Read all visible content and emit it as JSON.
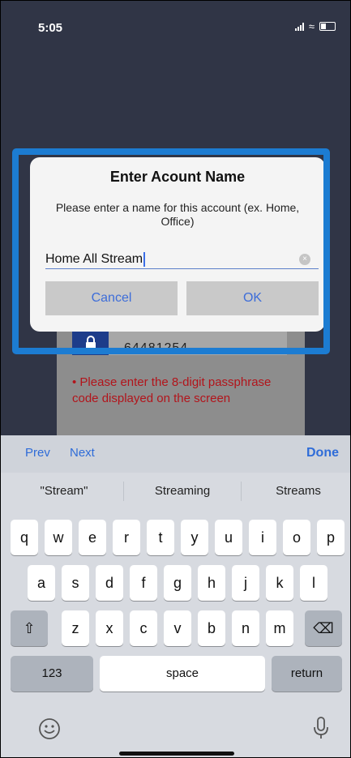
{
  "status_bar": {
    "time": "5:05"
  },
  "background": {
    "code": "64481254",
    "hint": "• Please enter the 8-digit passphrase code displayed on the screen"
  },
  "dialog": {
    "title": "Enter Acount Name",
    "message": "Please enter a name for this account (ex. Home, Office)",
    "input_value": "Home All Stream",
    "cancel_label": "Cancel",
    "ok_label": "OK"
  },
  "accessory_bar": {
    "prev": "Prev",
    "next": "Next",
    "done": "Done"
  },
  "suggestions": [
    "\"Stream\"",
    "Streaming",
    "Streams"
  ],
  "keyboard": {
    "row1": [
      "q",
      "w",
      "e",
      "r",
      "t",
      "y",
      "u",
      "i",
      "o",
      "p"
    ],
    "row2": [
      "a",
      "s",
      "d",
      "f",
      "g",
      "h",
      "j",
      "k",
      "l"
    ],
    "row3": [
      "z",
      "x",
      "c",
      "v",
      "b",
      "n",
      "m"
    ],
    "numbers": "123",
    "space": "space",
    "return": "return"
  },
  "icons": {
    "shift": "shift-icon",
    "delete": "delete-icon",
    "emoji": "emoji-icon",
    "mic": "microphone-icon",
    "lock": "lock-icon"
  },
  "colors": {
    "accent": "#2f6cd8",
    "highlight": "#1c7cd2",
    "error": "#b2141b"
  }
}
